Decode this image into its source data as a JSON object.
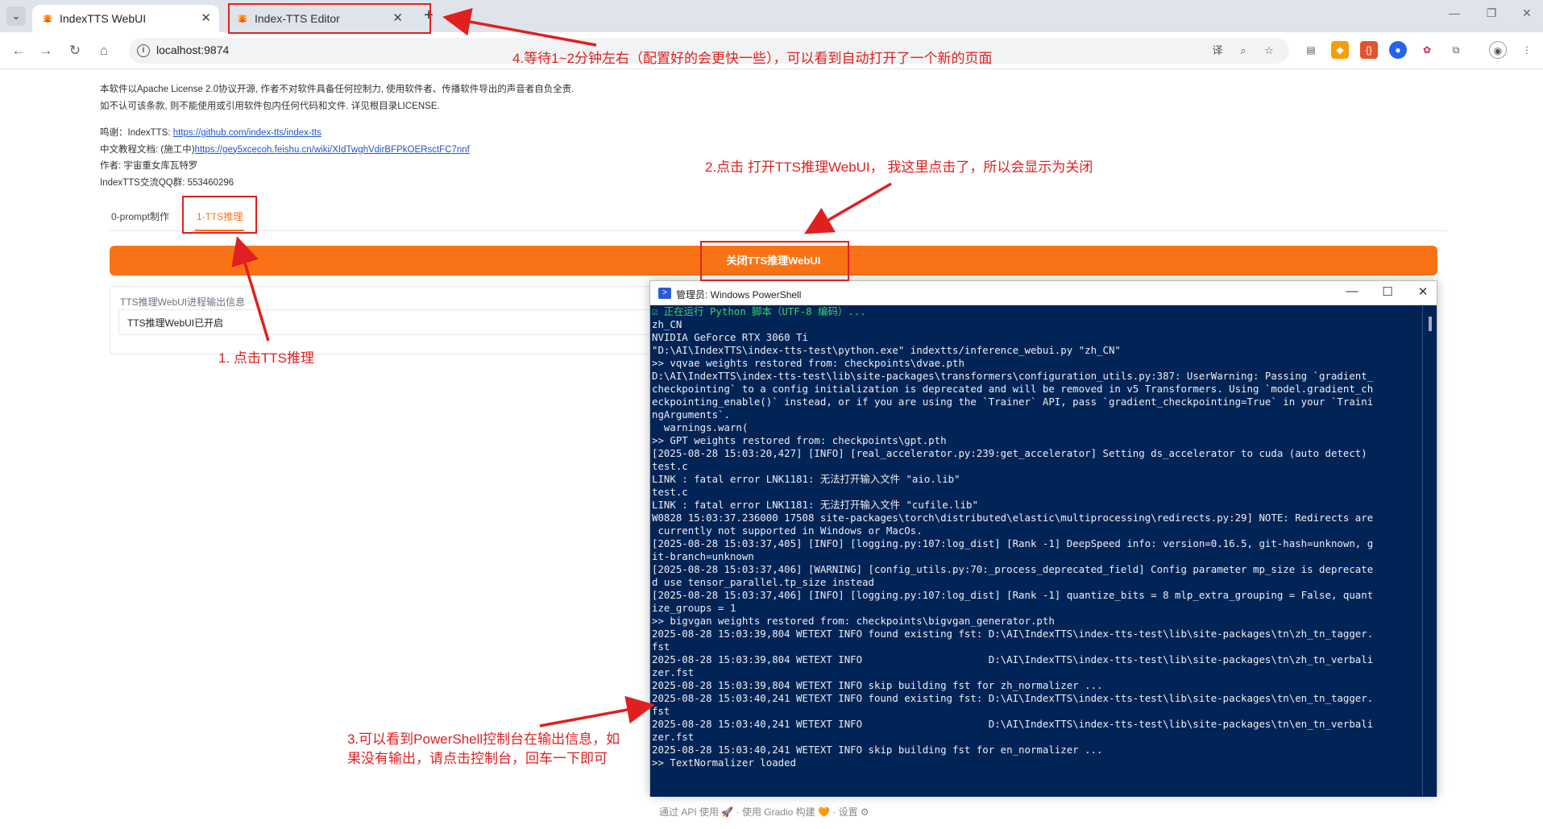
{
  "browser": {
    "tabs": [
      {
        "title": "IndexTTS WebUI",
        "active": true
      },
      {
        "title": "Index-TTS Editor",
        "active": false
      }
    ],
    "new_tab": "+",
    "url": "localhost:9874"
  },
  "page": {
    "license_lines": [
      "本软件以Apache License 2.0协议开源, 作者不对软件具备任何控制力, 使用软件者、传播软件导出的声音者自负全责.",
      "如不认可该条款, 则不能使用或引用软件包内任何代码和文件. 详见根目录LICENSE."
    ],
    "credits": {
      "thanks_prefix": "鸣谢：IndexTTS: ",
      "thanks_link": "https://github.com/index-tts/index-tts",
      "docs_prefix": "中文教程文档: (施工中)",
      "docs_link": "https://gey5xcecoh.feishu.cn/wiki/XIdTwghVdirBFPkOERsctFC7nnf",
      "author": "作者: 宇宙重女库瓦特罗",
      "qq": "IndexTTS交流QQ群: 553460296"
    },
    "tabs": [
      "0-prompt制作",
      "1-TTS推理"
    ],
    "toggle_button": "关闭TTS推理WebUI",
    "log_label": "TTS推理WebUI进程输出信息",
    "log_value": "TTS推理WebUI已开启",
    "footer": "通过 API 使用 🚀 · 使用 Gradio 构建 🧡 · 设置 ⚙"
  },
  "powershell": {
    "title": "管理员: Windows PowerShell",
    "lines": [
      "☑ 正在运行 Python 脚本（UTF-8 编码）...",
      "zh_CN",
      "NVIDIA GeForce RTX 3060 Ti",
      "\"D:\\AI\\IndexTTS\\index-tts-test\\python.exe\" indextts/inference_webui.py \"zh_CN\"",
      ">> vqvae weights restored from: checkpoints\\dvae.pth",
      "D:\\AI\\IndexTTS\\index-tts-test\\lib\\site-packages\\transformers\\configuration_utils.py:387: UserWarning: Passing `gradient_",
      "checkpointing` to a config initialization is deprecated and will be removed in v5 Transformers. Using `model.gradient_ch",
      "eckpointing_enable()` instead, or if you are using the `Trainer` API, pass `gradient_checkpointing=True` in your `Traini",
      "ngArguments`.",
      "  warnings.warn(",
      ">> GPT weights restored from: checkpoints\\gpt.pth",
      "[2025-08-28 15:03:20,427] [INFO] [real_accelerator.py:239:get_accelerator] Setting ds_accelerator to cuda (auto detect)",
      "test.c",
      "LINK : fatal error LNK1181: 无法打开输入文件 \"aio.lib\"",
      "test.c",
      "LINK : fatal error LNK1181: 无法打开输入文件 \"cufile.lib\"",
      "W0828 15:03:37.236000 17508 site-packages\\torch\\distributed\\elastic\\multiprocessing\\redirects.py:29] NOTE: Redirects are",
      " currently not supported in Windows or MacOs.",
      "[2025-08-28 15:03:37,405] [INFO] [logging.py:107:log_dist] [Rank -1] DeepSpeed info: version=0.16.5, git-hash=unknown, g",
      "it-branch=unknown",
      "[2025-08-28 15:03:37,406] [WARNING] [config_utils.py:70:_process_deprecated_field] Config parameter mp_size is deprecate",
      "d use tensor_parallel.tp_size instead",
      "[2025-08-28 15:03:37,406] [INFO] [logging.py:107:log_dist] [Rank -1] quantize_bits = 8 mlp_extra_grouping = False, quant",
      "ize_groups = 1",
      ">> bigvgan weights restored from: checkpoints\\bigvgan_generator.pth",
      "2025-08-28 15:03:39,804 WETEXT INFO found existing fst: D:\\AI\\IndexTTS\\index-tts-test\\lib\\site-packages\\tn\\zh_tn_tagger.",
      "fst",
      "2025-08-28 15:03:39,804 WETEXT INFO                     D:\\AI\\IndexTTS\\index-tts-test\\lib\\site-packages\\tn\\zh_tn_verbali",
      "zer.fst",
      "2025-08-28 15:03:39,804 WETEXT INFO skip building fst for zh_normalizer ...",
      "2025-08-28 15:03:40,241 WETEXT INFO found existing fst: D:\\AI\\IndexTTS\\index-tts-test\\lib\\site-packages\\tn\\en_tn_tagger.",
      "fst",
      "2025-08-28 15:03:40,241 WETEXT INFO                     D:\\AI\\IndexTTS\\index-tts-test\\lib\\site-packages\\tn\\en_tn_verbali",
      "zer.fst",
      "2025-08-28 15:03:40,241 WETEXT INFO skip building fst for en_normalizer ...",
      ">> TextNormalizer loaded"
    ]
  },
  "annotations": {
    "step1": "1. 点击TTS推理",
    "step2": "2.点击 打开TTS推理WebUI， 我这里点击了，所以会显示为关闭",
    "step3_line1": "3.可以看到PowerShell控制台在输出信息，如",
    "step3_line2": "果没有输出，请点击控制台，回车一下即可",
    "step4": "4.等待1~2分钟左右（配置好的会更快一些），可以看到自动打开了一个新的页面"
  },
  "icons": {
    "favicon": "orange-lightning-icon",
    "back": "back-arrow-icon",
    "forward": "forward-arrow-icon",
    "reload": "reload-icon",
    "home": "home-icon"
  },
  "colors": {
    "accent": "#f97316",
    "annotation": "#e02020",
    "console_bg": "#012456"
  }
}
